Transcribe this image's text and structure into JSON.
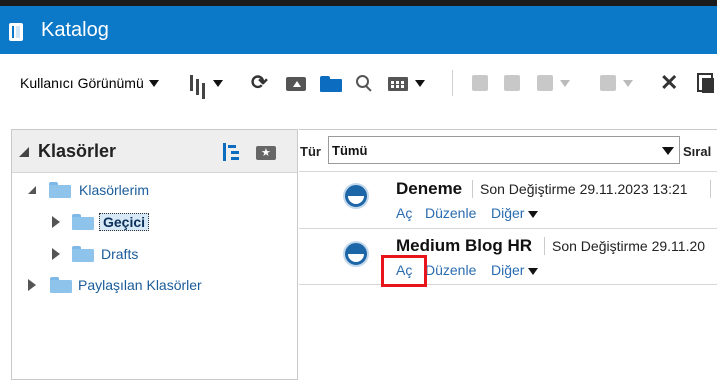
{
  "app": {
    "title": "Katalog",
    "icon": "book-icon"
  },
  "toolbar": {
    "view_label": "Kullanıcı Görünümü",
    "icons": [
      "hierarchy-icon",
      "refresh-icon",
      "upload-folder-icon",
      "open-folder-icon",
      "search-icon",
      "table-icon",
      "archive-icon",
      "edit-icon",
      "print-icon",
      "export-icon",
      "delete-icon",
      "copy-icon"
    ]
  },
  "sidebar": {
    "title": "Klasörler",
    "tree": [
      {
        "label": "Klasörlerim",
        "expanded": true
      },
      {
        "label": "Geçici",
        "selected": true
      },
      {
        "label": "Drafts"
      },
      {
        "label": "Paylaşılan Klasörler"
      }
    ]
  },
  "filter": {
    "type_label": "Tür",
    "type_value": "Tümü",
    "sort_label": "Sıral"
  },
  "items": [
    {
      "name": "Deneme",
      "modified": "Son Değiştirme 29.11.2023 13:21",
      "actions": {
        "open": "Aç",
        "edit": "Düzenle",
        "more": "Diğer"
      }
    },
    {
      "name": "Medium Blog HR",
      "modified": "Son Değiştirme 29.11.20",
      "actions": {
        "open": "Aç",
        "edit": "Düzenle",
        "more": "Diğer"
      }
    }
  ],
  "colors": {
    "titlebar": "#0b78c8",
    "link": "#2a6cb0",
    "highlight": "#e8141c"
  }
}
